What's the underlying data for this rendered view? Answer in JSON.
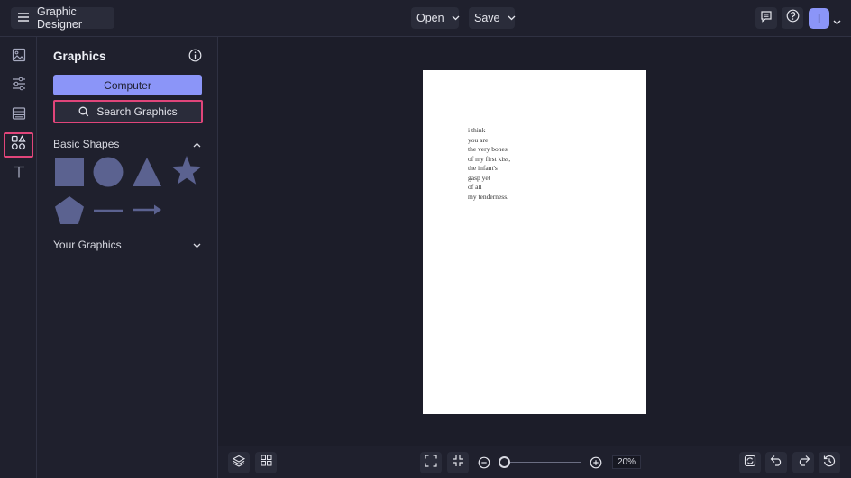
{
  "header": {
    "app_title": "Graphic Designer",
    "open_label": "Open",
    "save_label": "Save",
    "avatar_initial": "I",
    "icons": [
      "menu-icon",
      "chevron-down-icon",
      "comment-icon",
      "help-icon"
    ]
  },
  "rail": {
    "items": [
      "image-icon",
      "adjustments-icon",
      "layout-icon",
      "shapes-icon",
      "text-icon"
    ],
    "active_item": "shapes-icon"
  },
  "panel": {
    "title": "Graphics",
    "computer_button": "Computer",
    "search_button": "Search Graphics",
    "basic_shapes_label": "Basic Shapes",
    "your_graphics_label": "Your Graphics",
    "shapes": [
      "square",
      "circle",
      "triangle",
      "star",
      "pentagon",
      "line",
      "arrow"
    ]
  },
  "document": {
    "poem": [
      "i think",
      "you are",
      "the very bones",
      "of my first kiss,",
      "the infant's",
      "gasp yet",
      "of all",
      "my tenderness."
    ]
  },
  "footer": {
    "zoom_value": "20%",
    "icons": [
      "layers-icon",
      "grid-icon",
      "fit-screen-icon",
      "shrink-icon",
      "zoom-out-icon",
      "zoom-in-icon",
      "refresh-icon",
      "undo-icon",
      "redo-icon",
      "history-icon"
    ]
  },
  "colors": {
    "accent": "#8b95f8",
    "highlight": "#e0457a",
    "background": "#1c1d29",
    "panel": "#1f202d",
    "shape_fill": "#5b6290"
  }
}
